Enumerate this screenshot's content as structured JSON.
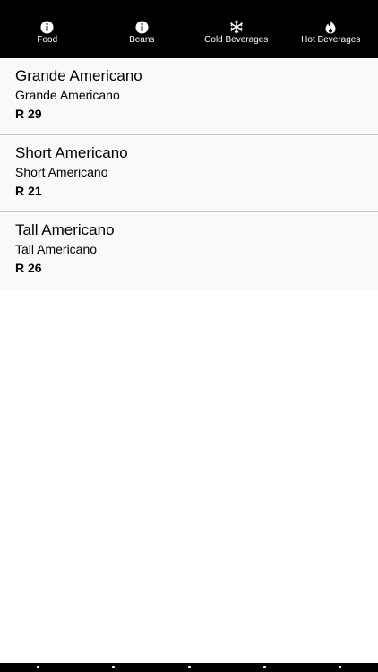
{
  "top_tabs": [
    {
      "label": "Food",
      "icon": "info-icon"
    },
    {
      "label": "Beans",
      "icon": "info-icon"
    },
    {
      "label": "Cold Beverages",
      "icon": "snowflake-icon"
    },
    {
      "label": "Hot Beverages",
      "icon": "flame-icon"
    }
  ],
  "items": [
    {
      "title": "Grande Americano",
      "subtitle": "Grande Americano",
      "price": "R 29"
    },
    {
      "title": "Short Americano",
      "subtitle": "Short Americano",
      "price": "R 21"
    },
    {
      "title": "Tall Americano",
      "subtitle": "Tall Americano",
      "price": "R 26"
    }
  ],
  "colors": {
    "tabbar_bg": "#000000",
    "tab_fg": "#ffffff",
    "row_bg": "#f9f9f9",
    "separator": "#c8c8c8"
  }
}
